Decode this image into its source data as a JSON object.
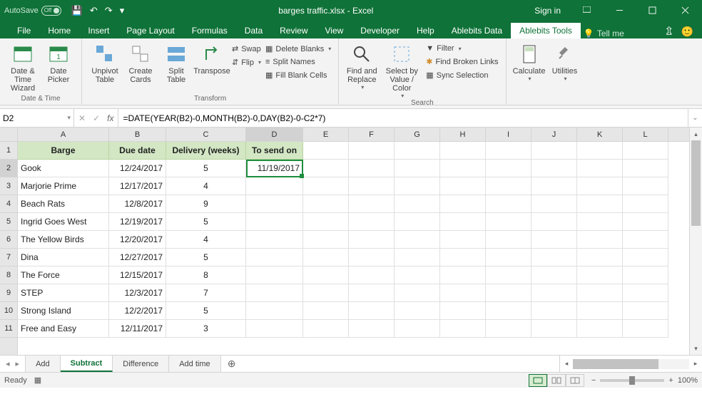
{
  "titlebar": {
    "autosave_label": "AutoSave",
    "autosave_state": "Off",
    "filename": "barges traffic.xlsx  -  Excel",
    "signin": "Sign in"
  },
  "tabs": {
    "items": [
      "File",
      "Home",
      "Insert",
      "Page Layout",
      "Formulas",
      "Data",
      "Review",
      "View",
      "Developer",
      "Help",
      "Ablebits Data",
      "Ablebits Tools"
    ],
    "active": "Ablebits Tools",
    "tellme": "Tell me"
  },
  "ribbon": {
    "datetime": {
      "wizard": "Date & Time Wizard",
      "picker": "Date Picker",
      "group": "Date & Time"
    },
    "transform": {
      "unpivot": "Unpivot Table",
      "cards": "Create Cards",
      "split": "Split Table",
      "transpose": "Transpose",
      "swap": "Swap",
      "flip": "Flip",
      "delete_blanks": "Delete Blanks",
      "split_names": "Split Names",
      "fill_blanks": "Fill Blank Cells",
      "group": "Transform"
    },
    "search": {
      "find": "Find and Replace",
      "select": "Select by Value / Color",
      "filter": "Filter",
      "broken": "Find Broken Links",
      "sync": "Sync Selection",
      "group": "Search"
    },
    "calc": {
      "calculate": "Calculate",
      "utilities": "Utilities"
    }
  },
  "fbar": {
    "namebox": "D2",
    "fx": "fx",
    "formula": "=DATE(YEAR(B2)-0,MONTH(B2)-0,DAY(B2)-0-C2*7)"
  },
  "columns": [
    "A",
    "B",
    "C",
    "D",
    "E",
    "F",
    "G",
    "H",
    "I",
    "J",
    "K",
    "L"
  ],
  "headers": [
    "Barge",
    "Due date",
    "Delivery (weeks)",
    "To send on"
  ],
  "rows": [
    {
      "n": "1"
    },
    {
      "n": "2",
      "a": "Gook",
      "b": "12/24/2017",
      "c": "5",
      "d": "11/19/2017"
    },
    {
      "n": "3",
      "a": "Marjorie Prime",
      "b": "12/17/2017",
      "c": "4",
      "d": ""
    },
    {
      "n": "4",
      "a": "Beach Rats",
      "b": "12/8/2017",
      "c": "9",
      "d": ""
    },
    {
      "n": "5",
      "a": "Ingrid Goes West",
      "b": "12/19/2017",
      "c": "5",
      "d": ""
    },
    {
      "n": "6",
      "a": "The Yellow Birds",
      "b": "12/20/2017",
      "c": "4",
      "d": ""
    },
    {
      "n": "7",
      "a": "Dina",
      "b": "12/27/2017",
      "c": "5",
      "d": ""
    },
    {
      "n": "8",
      "a": "The Force",
      "b": "12/15/2017",
      "c": "8",
      "d": ""
    },
    {
      "n": "9",
      "a": "STEP",
      "b": "12/3/2017",
      "c": "7",
      "d": ""
    },
    {
      "n": "10",
      "a": "Strong Island",
      "b": "12/2/2017",
      "c": "5",
      "d": ""
    },
    {
      "n": "11",
      "a": "Free and Easy",
      "b": "12/11/2017",
      "c": "3",
      "d": ""
    }
  ],
  "sheets": {
    "items": [
      "Add",
      "Subtract",
      "Difference",
      "Add time"
    ],
    "active": "Subtract"
  },
  "status": {
    "ready": "Ready",
    "zoom": "100%"
  }
}
